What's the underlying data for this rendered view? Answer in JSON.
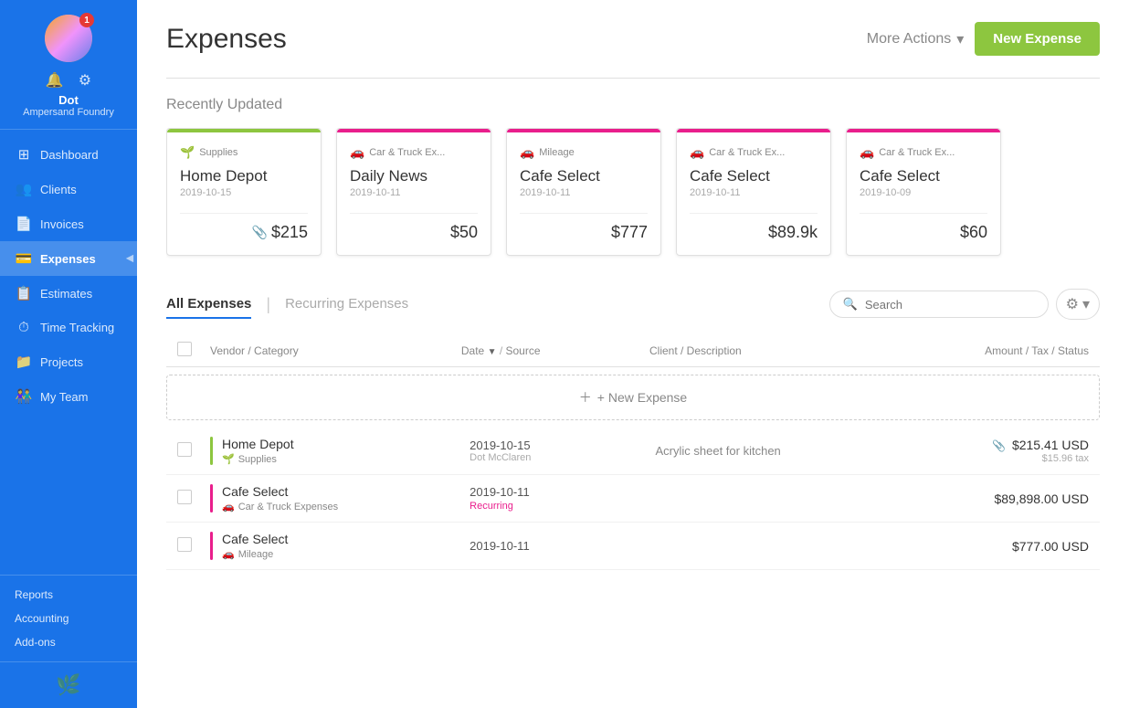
{
  "sidebar": {
    "user": {
      "name": "Dot",
      "company": "Ampersand Foundry"
    },
    "notification_count": "1",
    "nav_items": [
      {
        "id": "dashboard",
        "label": "Dashboard",
        "icon": "⊞",
        "active": false
      },
      {
        "id": "clients",
        "label": "Clients",
        "icon": "👥",
        "active": false
      },
      {
        "id": "invoices",
        "label": "Invoices",
        "icon": "📄",
        "active": false
      },
      {
        "id": "expenses",
        "label": "Expenses",
        "icon": "💳",
        "active": true
      },
      {
        "id": "estimates",
        "label": "Estimates",
        "icon": "📋",
        "active": false
      },
      {
        "id": "time-tracking",
        "label": "Time Tracking",
        "icon": "⏱",
        "active": false
      },
      {
        "id": "projects",
        "label": "Projects",
        "icon": "📁",
        "active": false
      },
      {
        "id": "my-team",
        "label": "My Team",
        "icon": "👫",
        "active": false
      }
    ],
    "bottom_links": [
      {
        "id": "reports",
        "label": "Reports"
      },
      {
        "id": "accounting",
        "label": "Accounting"
      },
      {
        "id": "add-ons",
        "label": "Add-ons"
      }
    ]
  },
  "header": {
    "title": "Expenses",
    "more_actions_label": "More Actions",
    "new_expense_label": "New Expense"
  },
  "recently_updated": {
    "section_title": "Recently Updated",
    "cards": [
      {
        "category": "Supplies",
        "vendor": "Home Depot",
        "date": "2019-10-15",
        "amount": "$215",
        "has_attachment": true,
        "bar_color": "green"
      },
      {
        "category": "Car & Truck Ex...",
        "vendor": "Daily News",
        "date": "2019-10-11",
        "amount": "$50",
        "has_attachment": false,
        "bar_color": "pink"
      },
      {
        "category": "Mileage",
        "vendor": "Cafe Select",
        "date": "2019-10-11",
        "amount": "$777",
        "has_attachment": false,
        "bar_color": "pink"
      },
      {
        "category": "Car & Truck Ex...",
        "vendor": "Cafe Select",
        "date": "2019-10-11",
        "amount": "$89.9k",
        "has_attachment": false,
        "bar_color": "pink"
      },
      {
        "category": "Car & Truck Ex...",
        "vendor": "Cafe Select",
        "date": "2019-10-09",
        "amount": "$60",
        "has_attachment": false,
        "bar_color": "pink"
      }
    ]
  },
  "expenses_section": {
    "tabs": [
      {
        "id": "all",
        "label": "All Expenses",
        "active": true
      },
      {
        "id": "recurring",
        "label": "Recurring Expenses",
        "active": false
      }
    ],
    "search_placeholder": "Search",
    "table_headers": {
      "vendor": "Vendor / Category",
      "date": "Date",
      "source": "Source",
      "client": "Client / Description",
      "amount": "Amount / Tax / Status"
    },
    "new_expense_row_label": "+ New Expense",
    "rows": [
      {
        "id": "row1",
        "vendor": "Home Depot",
        "category": "Supplies",
        "date": "2019-10-15",
        "assigned_to": "Dot McClaren",
        "client": "Acrylic sheet for kitchen",
        "amount": "$215.41 USD",
        "tax": "$15.96 tax",
        "recurring": false,
        "has_attachment": true,
        "bar_color": "green"
      },
      {
        "id": "row2",
        "vendor": "Cafe Select",
        "category": "Car & Truck Expenses",
        "date": "2019-10-11",
        "assigned_to": "",
        "client": "",
        "amount": "$89,898.00 USD",
        "tax": "",
        "recurring": true,
        "recurring_label": "Recurring",
        "has_attachment": false,
        "bar_color": "pink"
      },
      {
        "id": "row3",
        "vendor": "Cafe Select",
        "category": "Mileage",
        "date": "2019-10-11",
        "assigned_to": "",
        "client": "",
        "amount": "$777.00 USD",
        "tax": "",
        "recurring": false,
        "has_attachment": false,
        "bar_color": "pink"
      }
    ]
  }
}
